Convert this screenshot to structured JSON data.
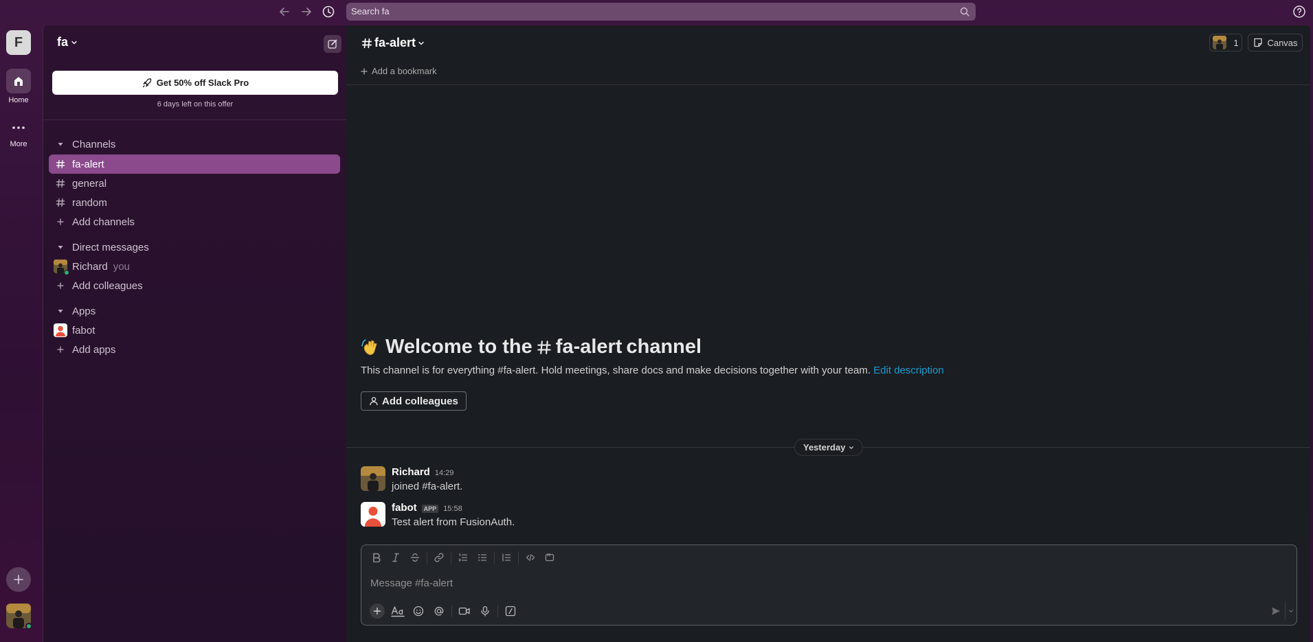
{
  "search": {
    "placeholder": "Search fa"
  },
  "rail": {
    "workspace_initial": "F",
    "home_label": "Home",
    "more_label": "More"
  },
  "sidebar": {
    "workspace_name": "fa",
    "promo_button": "Get 50% off Slack Pro",
    "promo_subtext": "6 days left on this offer",
    "channels_header": "Channels",
    "channels": [
      {
        "name": "fa-alert"
      },
      {
        "name": "general"
      },
      {
        "name": "random"
      }
    ],
    "add_channels": "Add channels",
    "dm_header": "Direct messages",
    "dm_user": "Richard",
    "dm_you": "you",
    "add_colleagues": "Add colleagues",
    "apps_header": "Apps",
    "app_name": "fabot",
    "add_apps": "Add apps"
  },
  "channel": {
    "name": "fa-alert",
    "member_count": "1",
    "canvas_label": "Canvas",
    "bookmark_label": "Add a bookmark",
    "welcome_prefix": "Welcome to the",
    "welcome_channel": "fa-alert",
    "welcome_suffix": "channel",
    "description": "This channel is for everything #fa-alert. Hold meetings, share docs and make decisions together with your team.",
    "edit_description": "Edit description",
    "add_colleagues_button": "Add colleagues",
    "day_divider": "Yesterday"
  },
  "messages": [
    {
      "author": "Richard",
      "time": "14:29",
      "text": "joined #fa-alert.",
      "app": ""
    },
    {
      "author": "fabot",
      "time": "15:58",
      "text": "Test alert from FusionAuth.",
      "app": "APP"
    }
  ],
  "composer": {
    "placeholder": "Message #fa-alert"
  },
  "icons": {
    "back": "arrow-left-icon",
    "forward": "arrow-right-icon",
    "history": "clock-icon",
    "search": "search-icon",
    "help": "help-icon",
    "home": "home-icon",
    "more": "ellipsis-icon",
    "compose": "compose-icon",
    "rocket": "rocket-icon",
    "hash": "hash-icon",
    "caret": "caret-down-icon"
  },
  "colors": {
    "active_channel": "#8a4a8c",
    "link": "#1d9bd1",
    "presence": "#2bac76",
    "fabot_avatar": "#e8503a"
  }
}
